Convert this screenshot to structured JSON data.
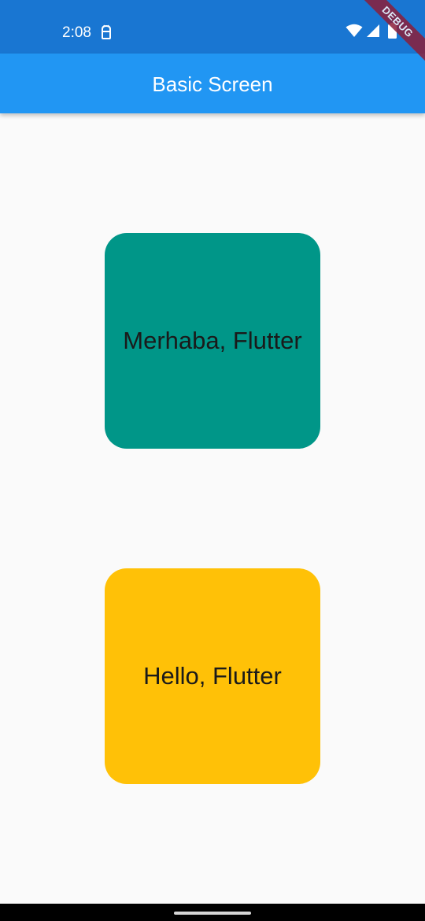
{
  "status_bar": {
    "time": "2:08",
    "notification_icon": "android-debug-icon",
    "wifi_icon": "wifi-icon",
    "signal_icon": "cell-signal-icon",
    "battery_icon": "battery-icon",
    "color": "#1976d2"
  },
  "debug_banner": {
    "label": "DEBUG"
  },
  "app_bar": {
    "title": "Basic Screen",
    "color": "#2196f3"
  },
  "cards": [
    {
      "text": "Merhaba, Flutter",
      "color": "#009688"
    },
    {
      "text": "Hello, Flutter",
      "color": "#ffc107"
    }
  ],
  "nav_bar": {
    "home_handle_icon": "home-gesture-handle"
  }
}
